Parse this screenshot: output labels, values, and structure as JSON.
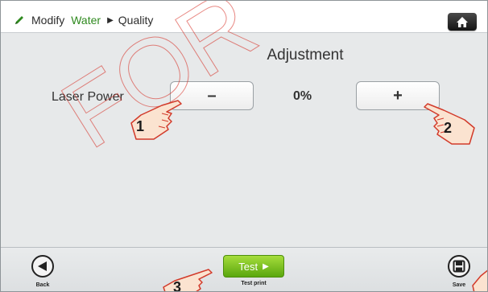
{
  "breadcrumb": {
    "item1": "Modify",
    "item2": "Water",
    "item3": "Quality"
  },
  "main": {
    "title": "Adjustment",
    "setting_label": "Laser Power",
    "minus_label": "–",
    "plus_label": "+",
    "value": "0%"
  },
  "footer": {
    "back_label": "Back",
    "test_label": "Test",
    "test_caption": "Test print",
    "save_label": "Save"
  },
  "annotations": {
    "step1": "1",
    "step2": "2",
    "step3": "3"
  },
  "colors": {
    "accent_green": "#2f8a1f",
    "test_button": "#7cc423",
    "hand_outline": "#d23a2a",
    "hand_fill": "#fbe3d0",
    "watermark": "#d6281e"
  },
  "icons": {
    "pencil": "pencil-icon",
    "home": "home-icon",
    "back": "back-arrow-icon",
    "save": "save-icon",
    "play": "play-icon",
    "pointer": "pointing-hand-icon"
  }
}
